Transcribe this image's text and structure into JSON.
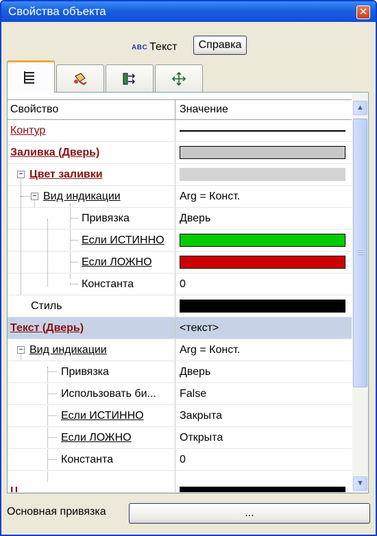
{
  "window": {
    "title": "Свойства объекта"
  },
  "object": {
    "type_icon": "ABC",
    "type_label": "Текст",
    "help_button": "Справка"
  },
  "tabs": [
    {
      "icon": "list-properties-icon",
      "active": true
    },
    {
      "icon": "paint-icon",
      "active": false
    },
    {
      "icon": "bindings-icon",
      "active": false
    },
    {
      "icon": "move-arrows-icon",
      "active": false
    }
  ],
  "grid": {
    "header": {
      "property": "Свойство",
      "value": "Значение"
    },
    "rows": {
      "kontur": {
        "label": "Контур",
        "value_kind": "line",
        "color": "#000000"
      },
      "fill_door": {
        "label": "Заливка (Дверь)",
        "value_kind": "swatch",
        "color": "#c8c8c8"
      },
      "fill_color": {
        "label": "Цвет заливки",
        "value_kind": "swatch",
        "color": "#d4d4d4"
      },
      "indication_1": {
        "label": "Вид индикации",
        "value": "Arg = Конст."
      },
      "binding_1": {
        "label": "Привязка",
        "value": "Дверь"
      },
      "if_true_1": {
        "label": "Если ИСТИННО",
        "value_kind": "swatch",
        "color": "#00cc00"
      },
      "if_false_1": {
        "label": "Если ЛОЖНО",
        "value_kind": "swatch",
        "color": "#cc0000"
      },
      "const_1": {
        "label": "Константа",
        "value": "0"
      },
      "style": {
        "label": "Стиль",
        "value_kind": "swatch",
        "color": "#000000"
      },
      "text_door": {
        "label": "Текст (Дверь)",
        "value": "<текст>"
      },
      "indication_2": {
        "label": "Вид индикации",
        "value": "Arg = Конст."
      },
      "binding_2": {
        "label": "Привязка",
        "value": "Дверь"
      },
      "use_bi": {
        "label": "Использовать би...",
        "value": "False"
      },
      "if_true_2": {
        "label": "Если ИСТИННО",
        "value": "Закрыта"
      },
      "if_false_2": {
        "label": "Если ЛОЖНО",
        "value": "Открыта"
      },
      "const_2": {
        "label": "Константа",
        "value": "0"
      },
      "partial": {
        "label": "Ц",
        "value_kind": "swatch",
        "color": "#000000"
      }
    },
    "selected_row": "text_door"
  },
  "footer": {
    "main_binding_label": "Основная привязка",
    "main_binding_button": "..."
  },
  "colors": {
    "title_bar": "#1a5fe0",
    "link_red": "#8b1010",
    "selection": "#c6d3e6",
    "tab_highlight": "#f7a53b"
  }
}
